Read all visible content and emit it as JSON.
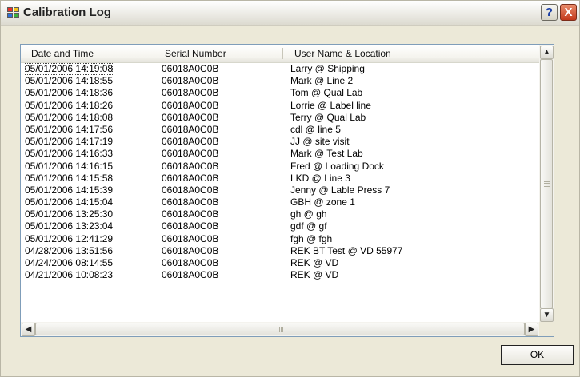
{
  "window": {
    "title": "Calibration Log",
    "help_label": "?",
    "close_label": "X"
  },
  "table": {
    "columns": [
      "Date and Time",
      "Serial Number",
      "User Name & Location"
    ],
    "rows": [
      [
        "05/01/2006 14:19:08",
        "06018A0C0B",
        "Larry @ Shipping"
      ],
      [
        "05/01/2006 14:18:55",
        "06018A0C0B",
        "Mark @ Line 2"
      ],
      [
        "05/01/2006 14:18:36",
        "06018A0C0B",
        "Tom @ Qual Lab"
      ],
      [
        "05/01/2006 14:18:26",
        "06018A0C0B",
        "Lorrie @ Label line"
      ],
      [
        "05/01/2006 14:18:08",
        "06018A0C0B",
        "Terry @ Qual Lab"
      ],
      [
        "05/01/2006 14:17:56",
        "06018A0C0B",
        "cdl @ line 5"
      ],
      [
        "05/01/2006 14:17:19",
        "06018A0C0B",
        "JJ @ site visit"
      ],
      [
        "05/01/2006 14:16:33",
        "06018A0C0B",
        "Mark @ Test Lab"
      ],
      [
        "05/01/2006 14:16:15",
        "06018A0C0B",
        "Fred @ Loading Dock"
      ],
      [
        "05/01/2006 14:15:58",
        "06018A0C0B",
        "LKD @ Line 3"
      ],
      [
        "05/01/2006 14:15:39",
        "06018A0C0B",
        "Jenny @ Lable Press 7"
      ],
      [
        "05/01/2006 14:15:04",
        "06018A0C0B",
        "GBH @ zone 1"
      ],
      [
        "05/01/2006 13:25:30",
        "06018A0C0B",
        "gh @ gh"
      ],
      [
        "05/01/2006 13:23:04",
        "06018A0C0B",
        "gdf @ gf"
      ],
      [
        "05/01/2006 12:41:29",
        "06018A0C0B",
        "fgh @ fgh"
      ],
      [
        "04/28/2006 13:51:56",
        "06018A0C0B",
        "REK BT Test @ VD 55977"
      ],
      [
        "04/24/2006 08:14:55",
        "06018A0C0B",
        "REK @ VD"
      ],
      [
        "04/21/2006 10:08:23",
        "06018A0C0B",
        "REK @ VD"
      ]
    ],
    "selected_index": 0
  },
  "scrollbar": {
    "up": "▲",
    "down": "▼",
    "left": "◀",
    "right": "▶"
  },
  "buttons": {
    "ok_label": "OK"
  }
}
